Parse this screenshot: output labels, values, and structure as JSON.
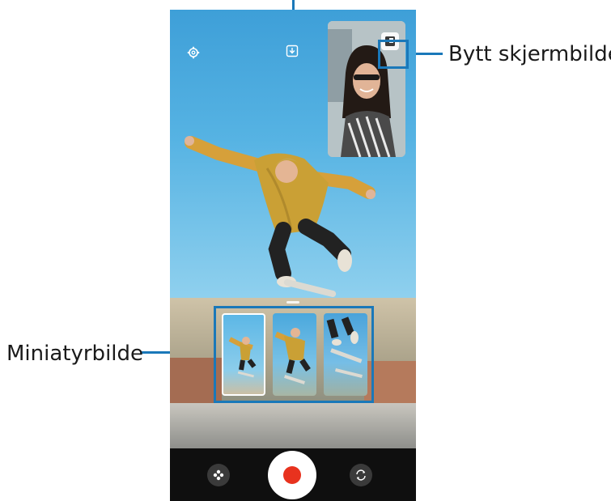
{
  "callouts": {
    "swap_screen": "Bytt skjermbilde.",
    "thumbnail": "Miniatyrbilde"
  },
  "icons": {
    "settings": "gear-icon",
    "save": "download-icon",
    "swap": "swap-screen-icon",
    "filter": "filter-icon",
    "record": "record-icon",
    "switch_camera": "switch-camera-icon"
  },
  "colors": {
    "callout": "#1a78b9",
    "record": "#e8321e",
    "bottom_bar": "#0f0f0f"
  },
  "thumbnails": {
    "count": 3,
    "selected_index": 0
  }
}
